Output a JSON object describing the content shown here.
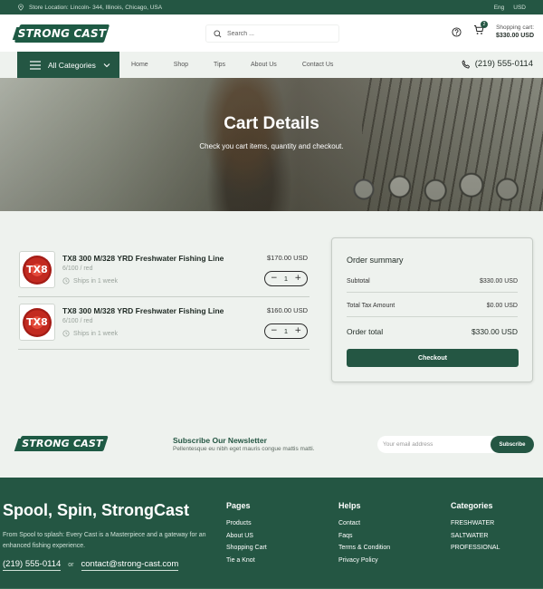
{
  "topbar": {
    "store_location": "Store Location: Lincoln- 344, Illinois, Chicago, USA",
    "language": "Eng",
    "currency": "USD"
  },
  "header": {
    "logo_text": "STRONG CAST",
    "search_placeholder": "Search ...",
    "cart_count": "2",
    "cart_label": "Shopping cart:",
    "cart_total": "$330.00 USD"
  },
  "nav": {
    "all_categories": "All Categories",
    "links": [
      "Home",
      "Shop",
      "Tips",
      "About Us",
      "Contact Us"
    ],
    "phone": "(219) 555-0114"
  },
  "hero": {
    "title": "Cart Details",
    "subtitle": "Check you cart items, quantity and checkout."
  },
  "cart": {
    "items": [
      {
        "name": "TX8 300 M/328 YRD Freshwater Fishing Line",
        "variant": "6/100 / red",
        "shipping": "Ships in 1 week",
        "price": "$170.00 USD",
        "quantity": "1",
        "thumb_text": "TX8"
      },
      {
        "name": "TX8 300 M/328 YRD Freshwater Fishing Line",
        "variant": "6/100 / red",
        "shipping": "Ships in 1 week",
        "price": "$160.00 USD",
        "quantity": "1",
        "thumb_text": "TX8"
      }
    ]
  },
  "summary": {
    "title": "Order summary",
    "subtitle_label": "Subtotal",
    "subtitle_value": "$330.00 USD",
    "tax_label": "Total Tax Amount",
    "tax_value": "$0.00 USD",
    "total_label": "Order total",
    "total_value": "$330.00 USD",
    "checkout": "Checkout"
  },
  "newsletter": {
    "logo_text": "STRONG CAST",
    "title": "Subscribe Our Newsletter",
    "subtitle": "Pellentesque eu nibh eget mauris congue mattis matti.",
    "placeholder": "Your email address",
    "button": "Subscribe"
  },
  "footer": {
    "title": "Spool, Spin, StrongCast",
    "description": "From Spool to splash: Every Cast is a Masterpiece and a gateway for an enhanced fishing experience.",
    "phone": "(219) 555-0114",
    "or": "or",
    "email": "contact@strong-cast.com",
    "pages": {
      "heading": "Pages",
      "links": [
        "Products",
        "About US",
        "Shopping Cart",
        "Tie a Knot"
      ]
    },
    "helps": {
      "heading": "Helps",
      "links": [
        "Contact",
        "Faqs",
        "Terms & Condition",
        "Privacy Policy"
      ]
    },
    "categories": {
      "heading": "Categories",
      "links": [
        "FRESHWATER",
        "SALTWATER",
        "PROFESSIONAL"
      ]
    }
  },
  "colors": {
    "brand_green": "#245643",
    "page_bg": "#eef2ee"
  }
}
